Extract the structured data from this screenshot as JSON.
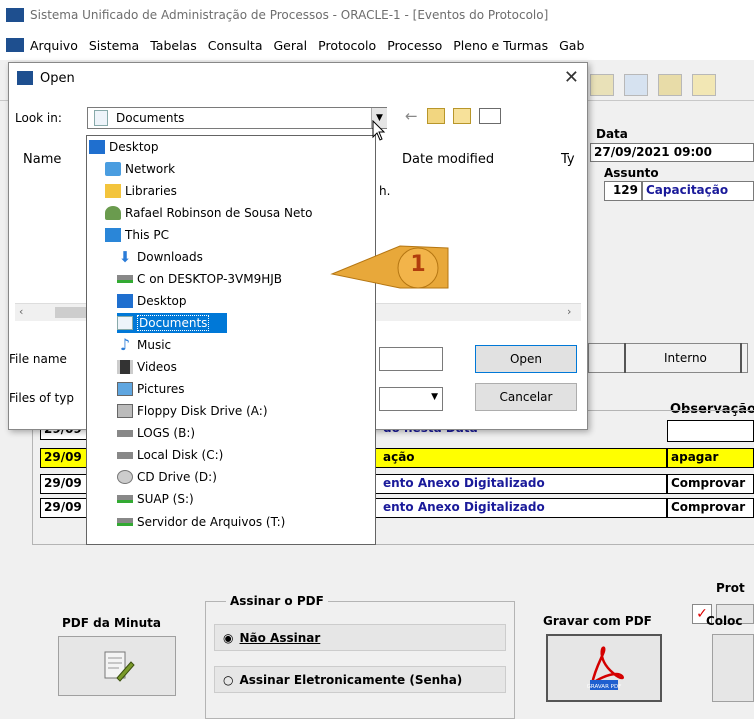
{
  "app": {
    "title": "Sistema Unificado de Administração de Processos - ORACLE-1 - [Eventos do Protocolo]",
    "menu": [
      "Arquivo",
      "Sistema",
      "Tabelas",
      "Consulta",
      "Geral",
      "Protocolo",
      "Processo",
      "Pleno e Turmas",
      "Gab"
    ]
  },
  "form": {
    "data_label": "Data",
    "data_value": "27/09/2021 09:00",
    "assunto_label": "Assunto",
    "assunto_code": "129",
    "assunto_text": "Capacitação",
    "interno_label": "Interno",
    "observacao_header": "Observação",
    "rows": [
      {
        "date": "29/09",
        "desc": "do nesta Data",
        "obs": ""
      },
      {
        "date": "29/09",
        "desc": "ação",
        "obs": "apagar"
      },
      {
        "date": "29/09",
        "desc": "ento Anexo Digitalizado",
        "obs": "Comprovar"
      },
      {
        "date": "29/09",
        "desc": "ento Anexo Digitalizado",
        "obs": "Comprovar"
      }
    ],
    "proto_label": "Prot",
    "pdf_minuta_label": "PDF da Minuta",
    "assinar_group_label": "Assinar o PDF",
    "nao_assinar_label": "Não Assinar",
    "assinar_eletr_label": "Assinar Eletronicamente (Senha)",
    "gravar_pdf_label": "Gravar com PDF",
    "colocar_label": "Coloc",
    "gravar_icon_text": "GRAVAR PDF"
  },
  "dialog": {
    "title": "Open",
    "look_in_label": "Look in:",
    "look_in_value": "Documents",
    "col_name": "Name",
    "col_date": "Date modified",
    "col_type": "Ty",
    "hint_text": "h.",
    "file_name_label": "File name",
    "files_of_type_label": "Files of typ",
    "open_button": "Open",
    "cancel_button": "Cancelar"
  },
  "dropdown_items": [
    {
      "label": "Desktop",
      "icon": "desktop-icon",
      "indent": 0
    },
    {
      "label": "Network",
      "icon": "network-icon",
      "indent": 1
    },
    {
      "label": "Libraries",
      "icon": "libraries-icon",
      "indent": 1
    },
    {
      "label": "Rafael Robinson de Sousa Neto",
      "icon": "user-icon",
      "indent": 1
    },
    {
      "label": "This PC",
      "icon": "pc-icon",
      "indent": 1
    },
    {
      "label": "Downloads",
      "icon": "downloads-icon",
      "indent": 2
    },
    {
      "label": "C on DESKTOP-3VM9HJB",
      "icon": "network-drive-icon",
      "indent": 2
    },
    {
      "label": "Desktop",
      "icon": "desktop-icon",
      "indent": 2
    },
    {
      "label": "Documents",
      "icon": "documents-icon",
      "indent": 2,
      "selected": true
    },
    {
      "label": "Music",
      "icon": "music-icon",
      "indent": 2
    },
    {
      "label": "Videos",
      "icon": "videos-icon",
      "indent": 2
    },
    {
      "label": "Pictures",
      "icon": "pictures-icon",
      "indent": 2
    },
    {
      "label": "Floppy Disk Drive (A:)",
      "icon": "floppy-icon",
      "indent": 2
    },
    {
      "label": "LOGS (B:)",
      "icon": "drive-icon",
      "indent": 2
    },
    {
      "label": "Local Disk (C:)",
      "icon": "drive-icon",
      "indent": 2
    },
    {
      "label": "CD Drive (D:)",
      "icon": "cd-icon",
      "indent": 2
    },
    {
      "label": "SUAP (S:)",
      "icon": "network-drive-icon",
      "indent": 2
    },
    {
      "label": "Servidor de Arquivos (T:)",
      "icon": "network-drive-icon",
      "indent": 2
    }
  ],
  "callout": {
    "number": "1"
  },
  "colors": {
    "selection": "#0078d7",
    "callout": "#e8a83a",
    "highlight_row": "#ffff00",
    "dark_blue_text": "#1a1a9a"
  }
}
